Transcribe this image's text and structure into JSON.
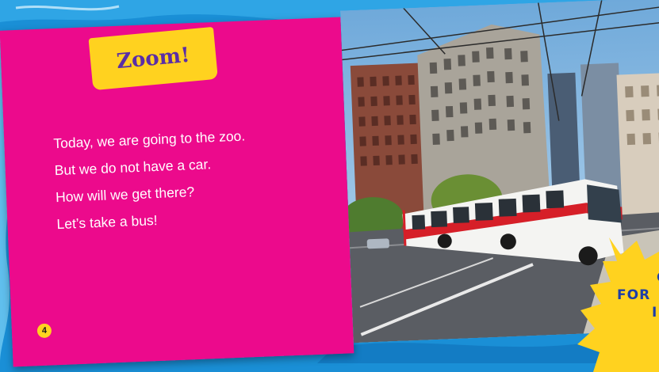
{
  "book": {
    "title": "Zoom!",
    "page_number": "4",
    "story_lines": [
      "Today, we are going to the zoo.",
      "But we do not have a car.",
      "How will we get there?",
      "Let’s take a bus!"
    ]
  },
  "burst_text": {
    "line1": "C",
    "line2": "FOR",
    "line3": "I"
  },
  "colors": {
    "background": "#1a8fd6",
    "page": "#ec0a8c",
    "title_tab": "#ffd21f",
    "title_text": "#5a2ea6",
    "burst": "#ffd21f",
    "burst_text": "#1d3da8"
  },
  "photo": {
    "subject": "red-and-white-city-bus",
    "icon": "bus-photo"
  }
}
